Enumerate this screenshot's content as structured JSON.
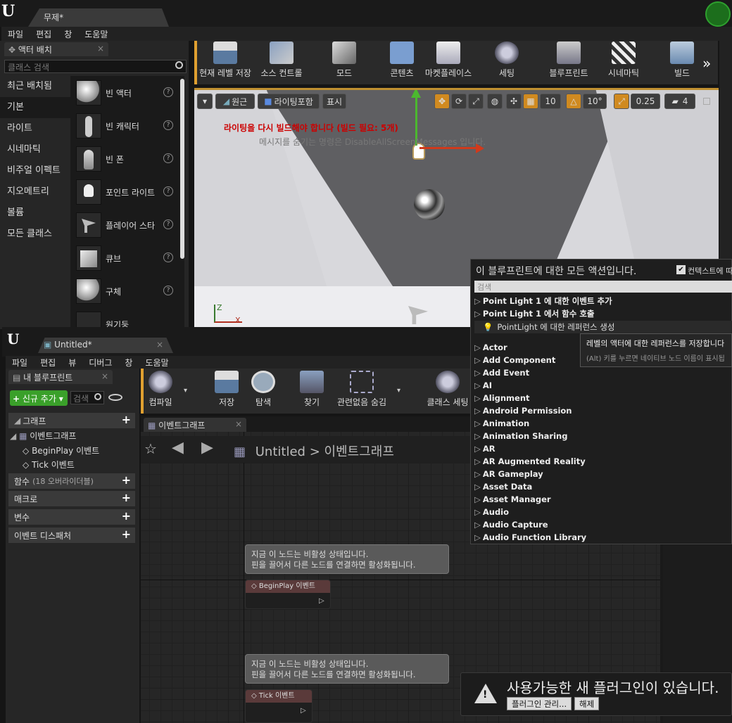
{
  "main": {
    "tab_title": "무제*",
    "menu": [
      "파일",
      "편집",
      "창",
      "도움말"
    ],
    "toolbar": [
      {
        "label": "현재 레벨 저장",
        "icon": "save-icon"
      },
      {
        "label": "소스 컨트롤",
        "icon": "source-control-icon"
      },
      {
        "label": "모드",
        "icon": "modes-icon"
      },
      {
        "label": "콘텐츠",
        "icon": "content-icon"
      },
      {
        "label": "마켓플레이스",
        "icon": "marketplace-icon"
      },
      {
        "label": "세팅",
        "icon": "settings-icon"
      },
      {
        "label": "블루프린트",
        "icon": "blueprint-icon"
      },
      {
        "label": "시네마틱",
        "icon": "cinematic-icon"
      },
      {
        "label": "빌드",
        "icon": "build-icon"
      }
    ]
  },
  "place_actors": {
    "title": "액터 배치",
    "search_placeholder": "클래스 검색",
    "categories": [
      "최근 배치됨",
      "기본",
      "라이트",
      "시네마틱",
      "비주얼 이펙트",
      "지오메트리",
      "볼륨",
      "모든 클래스"
    ],
    "selected_category": "기본",
    "items": [
      "빈 액터",
      "빈 캐릭터",
      "빈 폰",
      "포인트 라이트",
      "플레이어 스타",
      "큐브",
      "구체",
      "원기둥"
    ]
  },
  "viewport": {
    "perspective": "원근",
    "lit": "라이팅포함",
    "show": "표시",
    "grid_snap": "10",
    "rot_snap": "10°",
    "scale_snap": "0.25",
    "cam_speed": "4",
    "warning": "라이팅을 다시 빌드해야 합니다 (빌드 필요: 5개)",
    "warning_sub": "메시지를 숨기는 명령은 DisableAllScreenMessages 입니다."
  },
  "blueprint_editor": {
    "tab_title": "Untitled*",
    "menu": [
      "파일",
      "편집",
      "뷰",
      "디버그",
      "창",
      "도움말"
    ],
    "my_blueprint_title": "내 블루프린트",
    "add_new": "신규 추가",
    "search_placeholder": "검색",
    "toolbar": [
      {
        "label": "컴파일"
      },
      {
        "label": "저장"
      },
      {
        "label": "탐색"
      },
      {
        "label": "찾기"
      },
      {
        "label": "관련없음 숨김"
      },
      {
        "label": "클래스 세팅"
      }
    ],
    "sections": {
      "graph": "그래프",
      "event_graph": "이벤트그래프",
      "begin_play": "BeginPlay 이벤트",
      "tick": "Tick 이벤트",
      "functions": "함수",
      "functions_override": "(18 오버라이더블)",
      "macros": "매크로",
      "variables": "변수",
      "dispatchers": "이벤트 디스패처"
    },
    "graph_tab": "이벤트그래프",
    "breadcrumb_root": "Untitled",
    "breadcrumb_sep": ">",
    "breadcrumb_leaf": "이벤트그래프",
    "comment_line1": "지금 이 노드는 비활성 상태입니다.",
    "comment_line2": "핀을 끌어서 다른 노드를 연결하면 활성화됩니다.",
    "node_beginplay": "BeginPlay 이벤트",
    "node_tick": "Tick 이벤트"
  },
  "action_menu": {
    "title": "이 블루프린트에 대한 모든 액션입니다.",
    "context_label": "컨텍스트에 따",
    "search_placeholder": "검색",
    "items": [
      "Point Light 1 에 대한 이벤트 추가",
      "Point Light 1 에서 함수 호출",
      "Actor",
      "Add Component",
      "Add Event",
      "AI",
      "Alignment",
      "Android Permission",
      "Animation",
      "Animation Sharing",
      "AR",
      "AR Augmented Reality",
      "AR Gameplay",
      "Asset Data",
      "Asset Manager",
      "Audio",
      "Audio Capture",
      "Audio Function Library"
    ],
    "highlighted": "PointLight 에 대한 레퍼런스 생성",
    "tooltip_line1": "레벨의 액터에 대한 레퍼런스를 저장합니다",
    "tooltip_line2": "(Alt) 키를 누르면 네이티브 노드 이름이 표시됩"
  },
  "notification": {
    "text": "사용가능한 새 플러그인이 있습니다.",
    "manage": "플러그인 관리...",
    "dismiss": "해제"
  }
}
